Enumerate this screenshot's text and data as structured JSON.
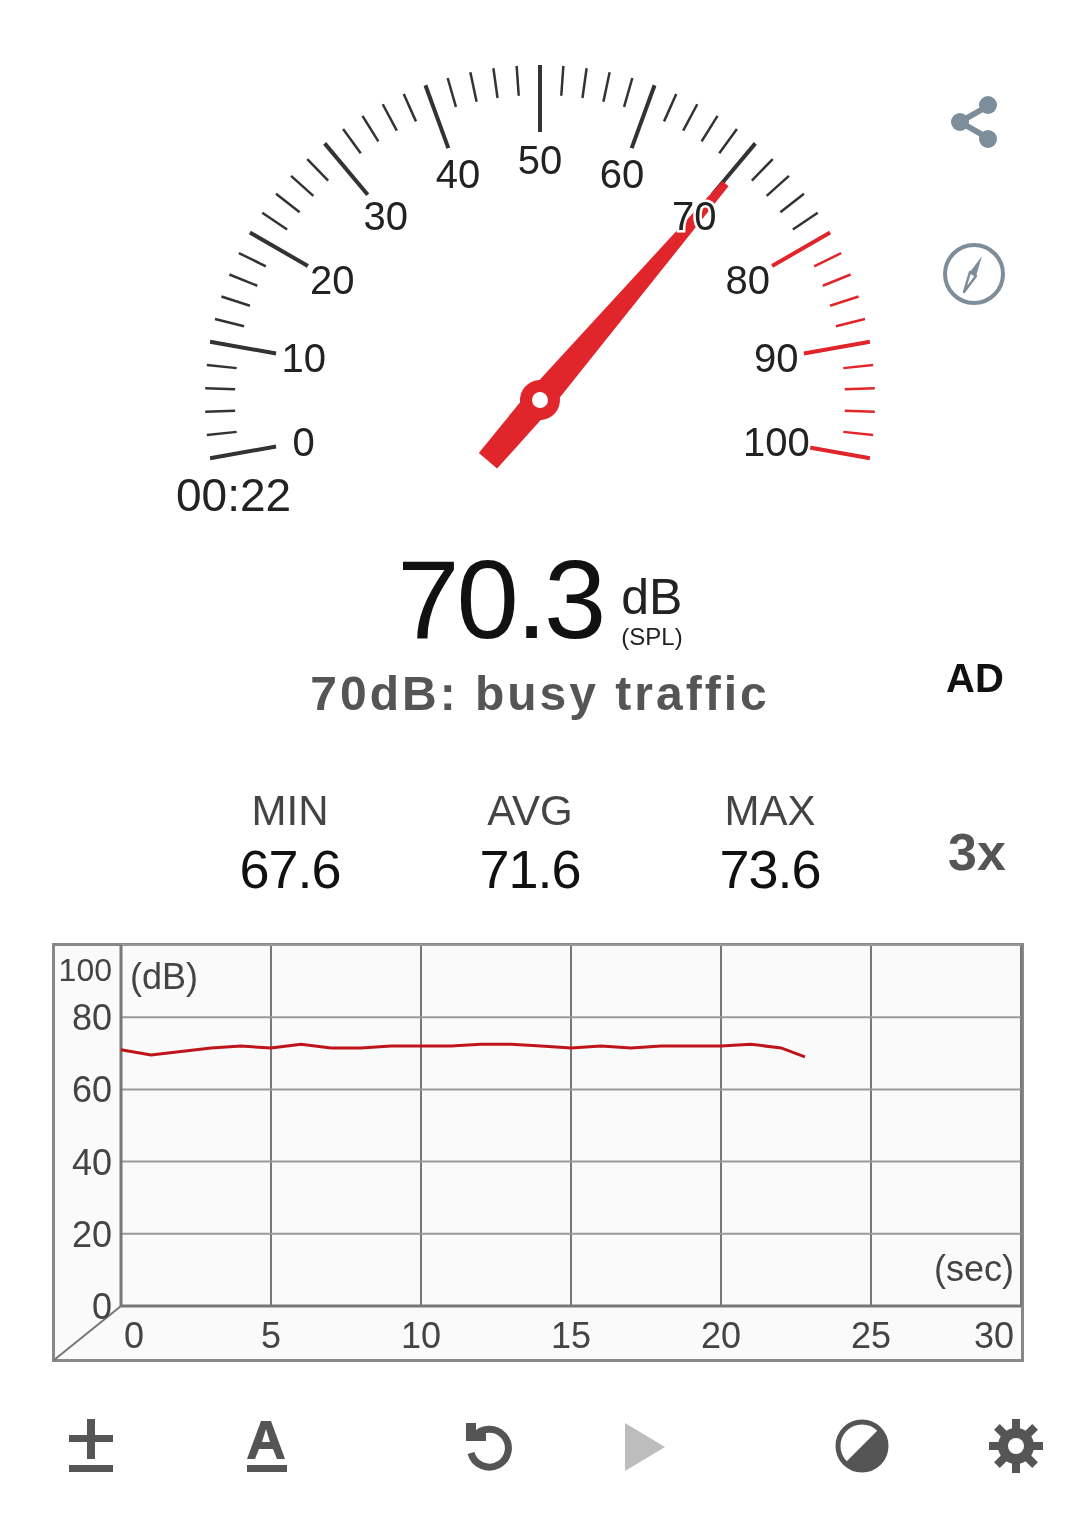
{
  "gauge": {
    "labels": [
      "50",
      "40",
      "60",
      "30",
      "70",
      "20",
      "80",
      "10",
      "90",
      "0",
      "100"
    ],
    "elapsed": "00:22"
  },
  "reading": {
    "value": "70.3",
    "unit": "dB",
    "weighting": "(SPL)",
    "description": "70dB: busy traffic",
    "mode": "AD"
  },
  "stats": [
    {
      "label": "MIN",
      "value": "67.6"
    },
    {
      "label": "AVG",
      "value": "71.6"
    },
    {
      "label": "MAX",
      "value": "73.6"
    }
  ],
  "zoom": "3x",
  "chart_data": {
    "type": "line",
    "grid": true,
    "xlabel": "(sec)",
    "ylabel": "(dB)",
    "xlim": [
      0,
      30
    ],
    "ylim": [
      0,
      100
    ],
    "xticks": [
      0,
      5,
      10,
      15,
      20,
      25,
      30
    ],
    "yticks": [
      0,
      20,
      40,
      60,
      80,
      100
    ],
    "x": [
      0,
      1,
      2,
      3,
      4,
      5,
      6,
      7,
      8,
      9,
      10,
      11,
      12,
      13,
      14,
      15,
      16,
      17,
      18,
      19,
      20,
      21,
      22,
      22.8
    ],
    "series": [
      {
        "color": "#c0141c",
        "values": [
          71,
          69.5,
          70.5,
          71.5,
          72,
          71.5,
          72.5,
          71.5,
          71.5,
          72,
          72,
          72,
          72.5,
          72.5,
          72,
          71.5,
          72,
          71.5,
          72,
          72,
          72,
          72.5,
          71.5,
          69
        ]
      }
    ]
  },
  "toolbar": [
    {
      "kind": "calibrate",
      "disabled": false
    },
    {
      "kind": "font",
      "disabled": false
    },
    {
      "kind": "reset",
      "disabled": false
    },
    {
      "kind": "play",
      "disabled": true
    },
    {
      "kind": "theme",
      "disabled": false
    },
    {
      "kind": "settings",
      "disabled": false
    }
  ]
}
